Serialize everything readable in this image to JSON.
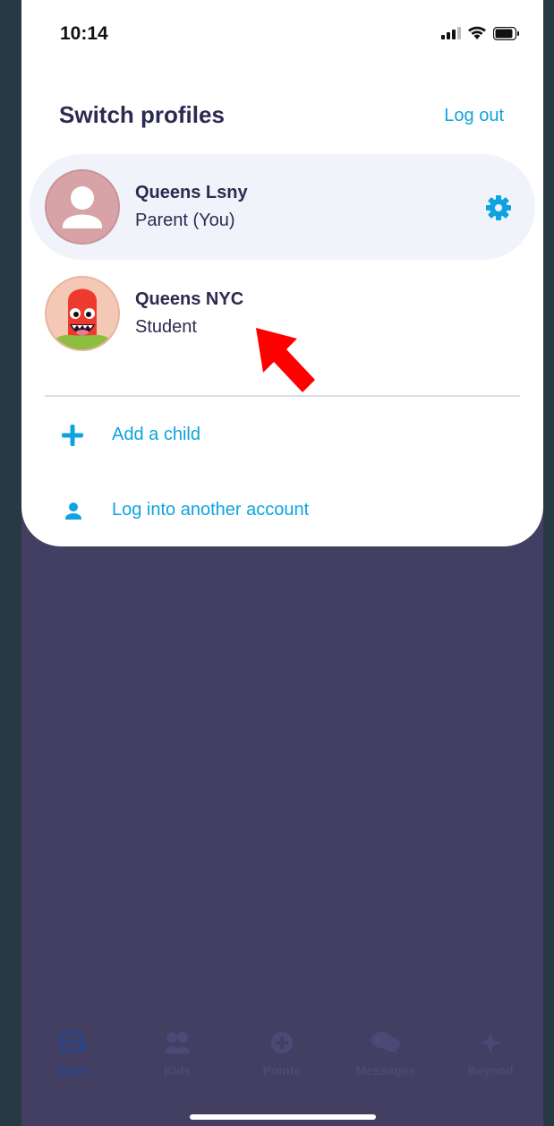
{
  "status_bar": {
    "time": "10:14"
  },
  "header": {
    "title": "Switch profiles",
    "logout_label": "Log out"
  },
  "profiles": [
    {
      "name": "Queens Lsny",
      "role": "Parent (You)",
      "selected": true
    },
    {
      "name": "Queens NYC",
      "role": "Student",
      "selected": false
    }
  ],
  "actions": {
    "add_child": "Add a child",
    "log_into_another": "Log into another account"
  },
  "tabs": [
    {
      "label": "Story",
      "icon": "story-icon",
      "active": true
    },
    {
      "label": "Kids",
      "icon": "kids-icon",
      "active": false
    },
    {
      "label": "Points",
      "icon": "points-icon",
      "active": false
    },
    {
      "label": "Messages",
      "icon": "messages-icon",
      "active": false
    },
    {
      "label": "Beyond",
      "icon": "beyond-icon",
      "active": false
    }
  ],
  "colors": {
    "accent": "#0ea3e0",
    "dark_text": "#2c2a50",
    "overlay": "#423f62",
    "annotation_arrow": "#ff0000"
  }
}
